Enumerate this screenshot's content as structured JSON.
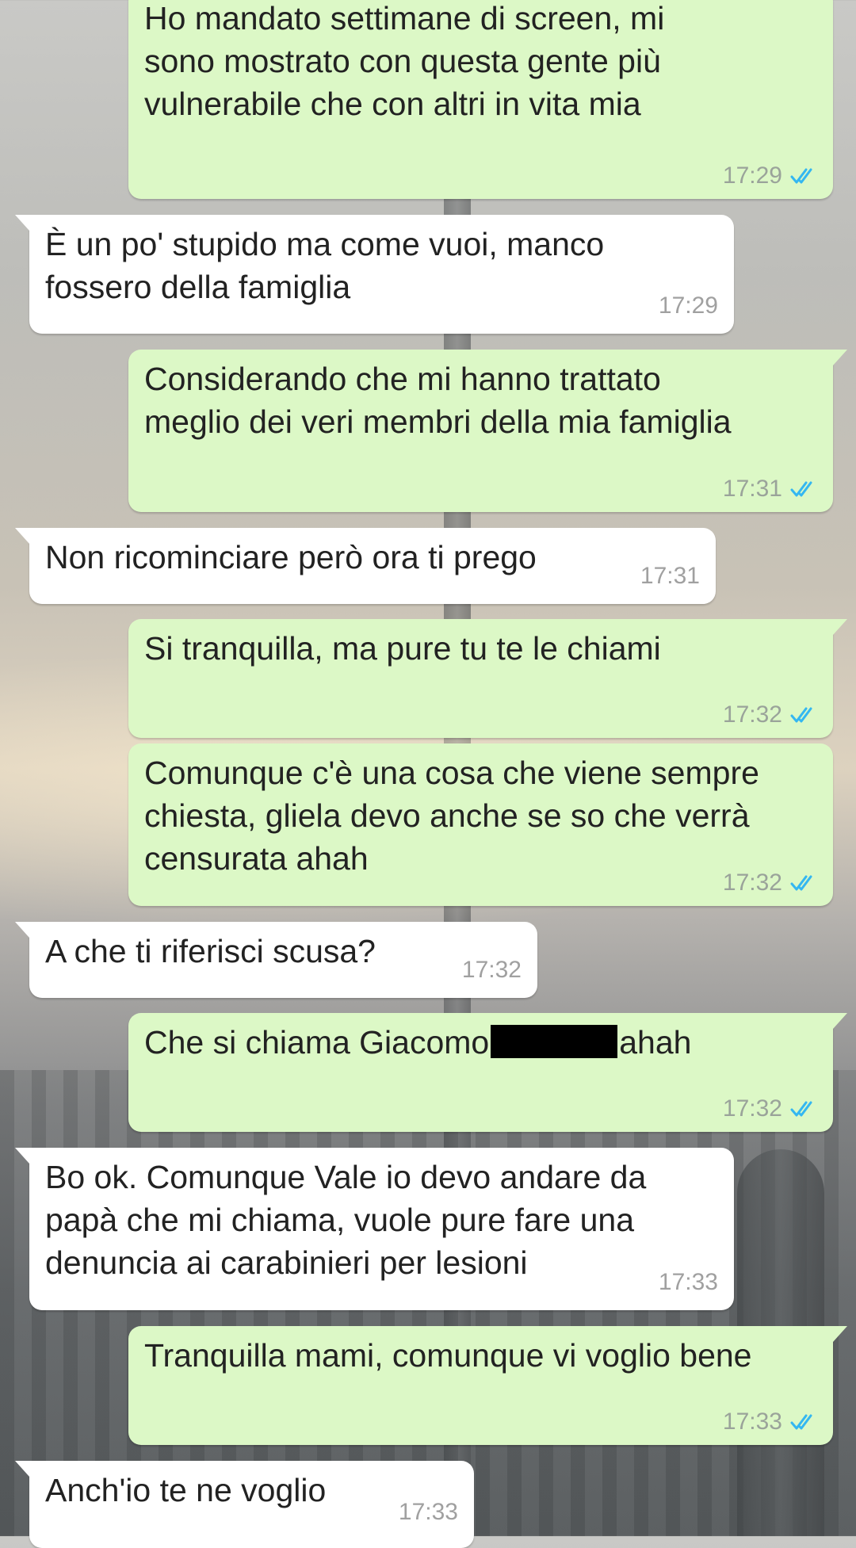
{
  "colors": {
    "outgoing_bubble": "#dcf8c6",
    "incoming_bubble": "#ffffff",
    "read_ticks": "#34b7f1"
  },
  "messages": [
    {
      "dir": "out",
      "text": "Ho mandato settimane di screen, mi\nsono mostrato con questa gente più\nvulnerabile che con altri in vita mia",
      "time": "17:29",
      "status": "read-ticks-icon"
    },
    {
      "dir": "in",
      "text": "È un po' stupido ma come vuoi, manco\nfossero della famiglia",
      "time": "17:29"
    },
    {
      "dir": "out",
      "text": "Considerando che mi hanno trattato\nmeglio dei veri membri della mia famiglia",
      "time": "17:31",
      "status": "read-ticks-icon"
    },
    {
      "dir": "in",
      "text": "Non ricominciare però ora ti prego",
      "time": "17:31"
    },
    {
      "dir": "out",
      "text": "Si tranquilla, ma pure tu te le chiami",
      "time": "17:32",
      "status": "read-ticks-icon"
    },
    {
      "dir": "out",
      "text": "Comunque c'è una cosa che viene sempre\nchiesta, gliela devo anche se so che verrà\ncensurata ahah",
      "time": "17:32",
      "status": "read-ticks-icon"
    },
    {
      "dir": "in",
      "text": "A che ti riferisci scusa?",
      "time": "17:32"
    },
    {
      "dir": "out",
      "text_before": "Che si chiama Giacomo",
      "text_after": "ahah",
      "time": "17:32",
      "status": "read-ticks-icon"
    },
    {
      "dir": "in",
      "text": "Bo ok. Comunque Vale io devo andare da\npapà che mi chiama, vuole pure fare una\ndenuncia ai carabinieri per lesioni",
      "time": "17:33"
    },
    {
      "dir": "out",
      "text": "Tranquilla mami, comunque vi voglio bene",
      "time": "17:33",
      "status": "read-ticks-icon"
    },
    {
      "dir": "in",
      "text": "Anch'io te ne voglio",
      "time": "17:33"
    }
  ]
}
